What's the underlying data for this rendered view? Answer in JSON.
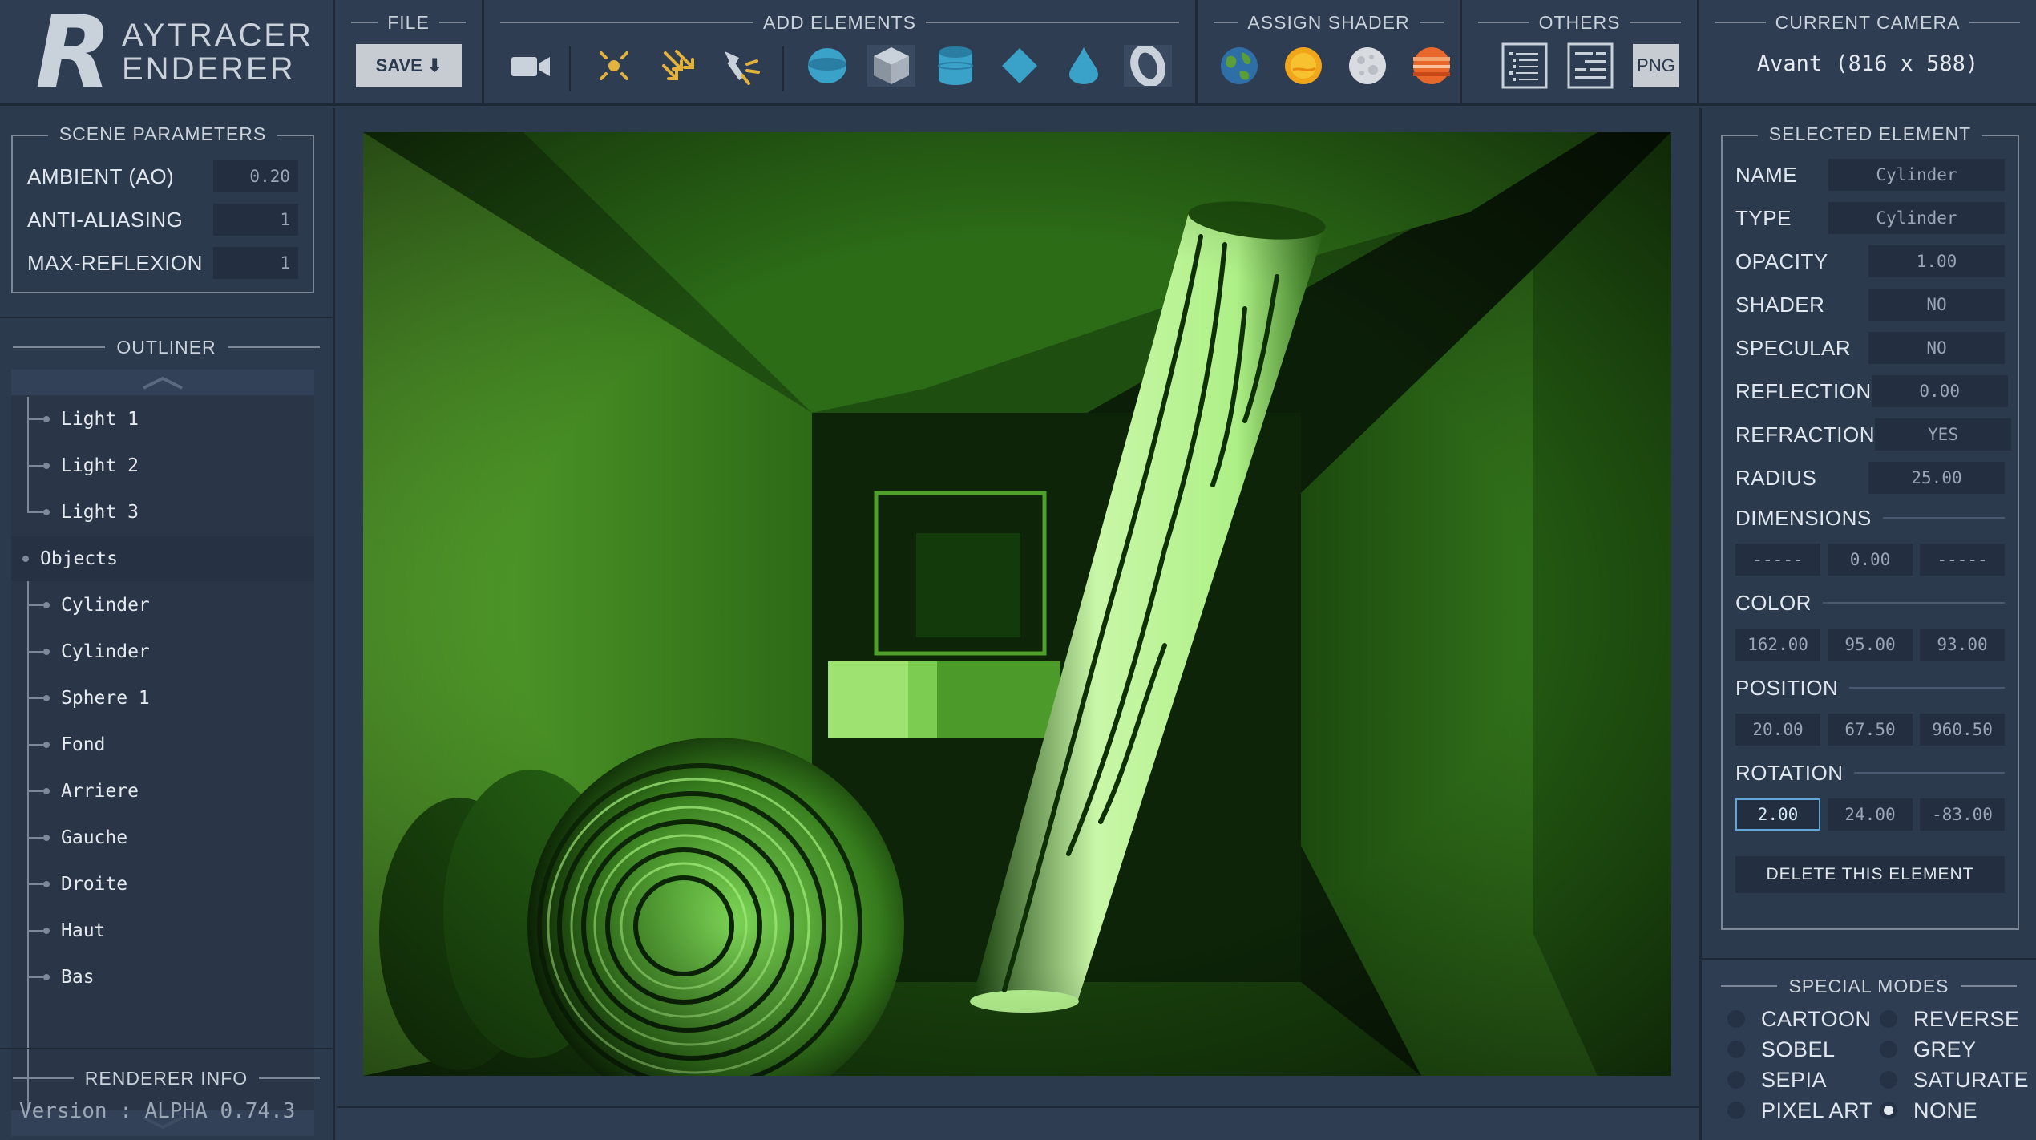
{
  "app": {
    "logo_letter": "R",
    "logo_line1": "AYTRACER",
    "logo_line2": "ENDERER"
  },
  "toolbar": {
    "file_title": "FILE",
    "save_label": "SAVE ⬇",
    "add_title": "ADD ELEMENTS",
    "shader_title": "ASSIGN SHADER",
    "others_title": "OTHERS",
    "png_label": "PNG",
    "camera_title": "CURRENT CAMERA",
    "camera_value": "Avant (816 x 588)",
    "add_icons": [
      "camera-icon",
      "point-light-icon",
      "directional-light-icon",
      "spot-light-icon",
      "sphere-icon",
      "cube-icon",
      "cylinder-icon",
      "diamond-icon",
      "cone-icon",
      "torus-icon"
    ],
    "shader_icons": [
      "earth-shader-icon",
      "sun-shader-icon",
      "moon-shader-icon",
      "jupiter-shader-icon"
    ],
    "other_icons": [
      "list-view-icon",
      "tree-view-icon",
      "png-export-icon"
    ]
  },
  "scene": {
    "title": "SCENE PARAMETERS",
    "params": [
      {
        "label": "AMBIENT (AO)",
        "value": "0.20"
      },
      {
        "label": "ANTI-ALIASING",
        "value": "1"
      },
      {
        "label": "MAX-REFLEXION",
        "value": "1"
      }
    ]
  },
  "outliner": {
    "title": "OUTLINER",
    "items": [
      {
        "label": "Light 1",
        "level": 1
      },
      {
        "label": "Light 2",
        "level": 1
      },
      {
        "label": "Light 3",
        "level": 1
      },
      {
        "label": "Objects",
        "level": 0
      },
      {
        "label": "Cylinder",
        "level": 1
      },
      {
        "label": "Cylinder",
        "level": 1
      },
      {
        "label": "Sphere 1",
        "level": 1
      },
      {
        "label": "Fond",
        "level": 1
      },
      {
        "label": "Arriere",
        "level": 1
      },
      {
        "label": "Gauche",
        "level": 1
      },
      {
        "label": "Droite",
        "level": 1
      },
      {
        "label": "Haut",
        "level": 1
      },
      {
        "label": "Bas",
        "level": 1
      }
    ]
  },
  "info": {
    "title": "RENDERER INFO",
    "version": "Version : ALPHA 0.74.3"
  },
  "selected": {
    "title": "SELECTED ELEMENT",
    "props": [
      {
        "label": "NAME",
        "value": "Cylinder",
        "wide": true
      },
      {
        "label": "TYPE",
        "value": "Cylinder",
        "wide": true
      },
      {
        "label": "OPACITY",
        "value": "1.00"
      },
      {
        "label": "SHADER",
        "value": "NO"
      },
      {
        "label": "SPECULAR",
        "value": "NO"
      },
      {
        "label": "REFLECTION",
        "value": "0.00"
      },
      {
        "label": "REFRACTION",
        "value": "YES"
      },
      {
        "label": "RADIUS",
        "value": "25.00"
      }
    ],
    "dimensions": {
      "label": "DIMENSIONS",
      "values": [
        "-----",
        "0.00",
        "-----"
      ]
    },
    "color": {
      "label": "COLOR",
      "values": [
        "162.00",
        "95.00",
        "93.00"
      ]
    },
    "position": {
      "label": "POSITION",
      "values": [
        "20.00",
        "67.50",
        "960.50"
      ]
    },
    "rotation": {
      "label": "ROTATION",
      "values": [
        "2.00",
        "24.00",
        "-83.00"
      ]
    },
    "delete_label": "DELETE THIS ELEMENT"
  },
  "modes": {
    "title": "SPECIAL MODES",
    "left": [
      "CARTOON",
      "SOBEL",
      "SEPIA",
      "PIXEL ART"
    ],
    "right": [
      "REVERSE",
      "GREY",
      "SATURATE",
      "NONE"
    ],
    "selected": "NONE"
  }
}
